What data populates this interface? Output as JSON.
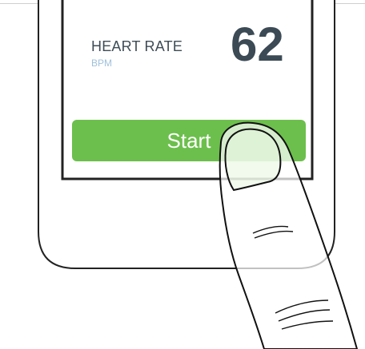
{
  "heart_rate": {
    "title": "HEART RATE",
    "unit": "BPM",
    "value": "62"
  },
  "start_button": {
    "label": "Start"
  },
  "colors": {
    "button_green": "#6cbf4c",
    "text_dark": "#3b4a55",
    "unit_blue": "#9fc1dc"
  },
  "icons": {
    "finger": "pointing-finger-icon"
  }
}
